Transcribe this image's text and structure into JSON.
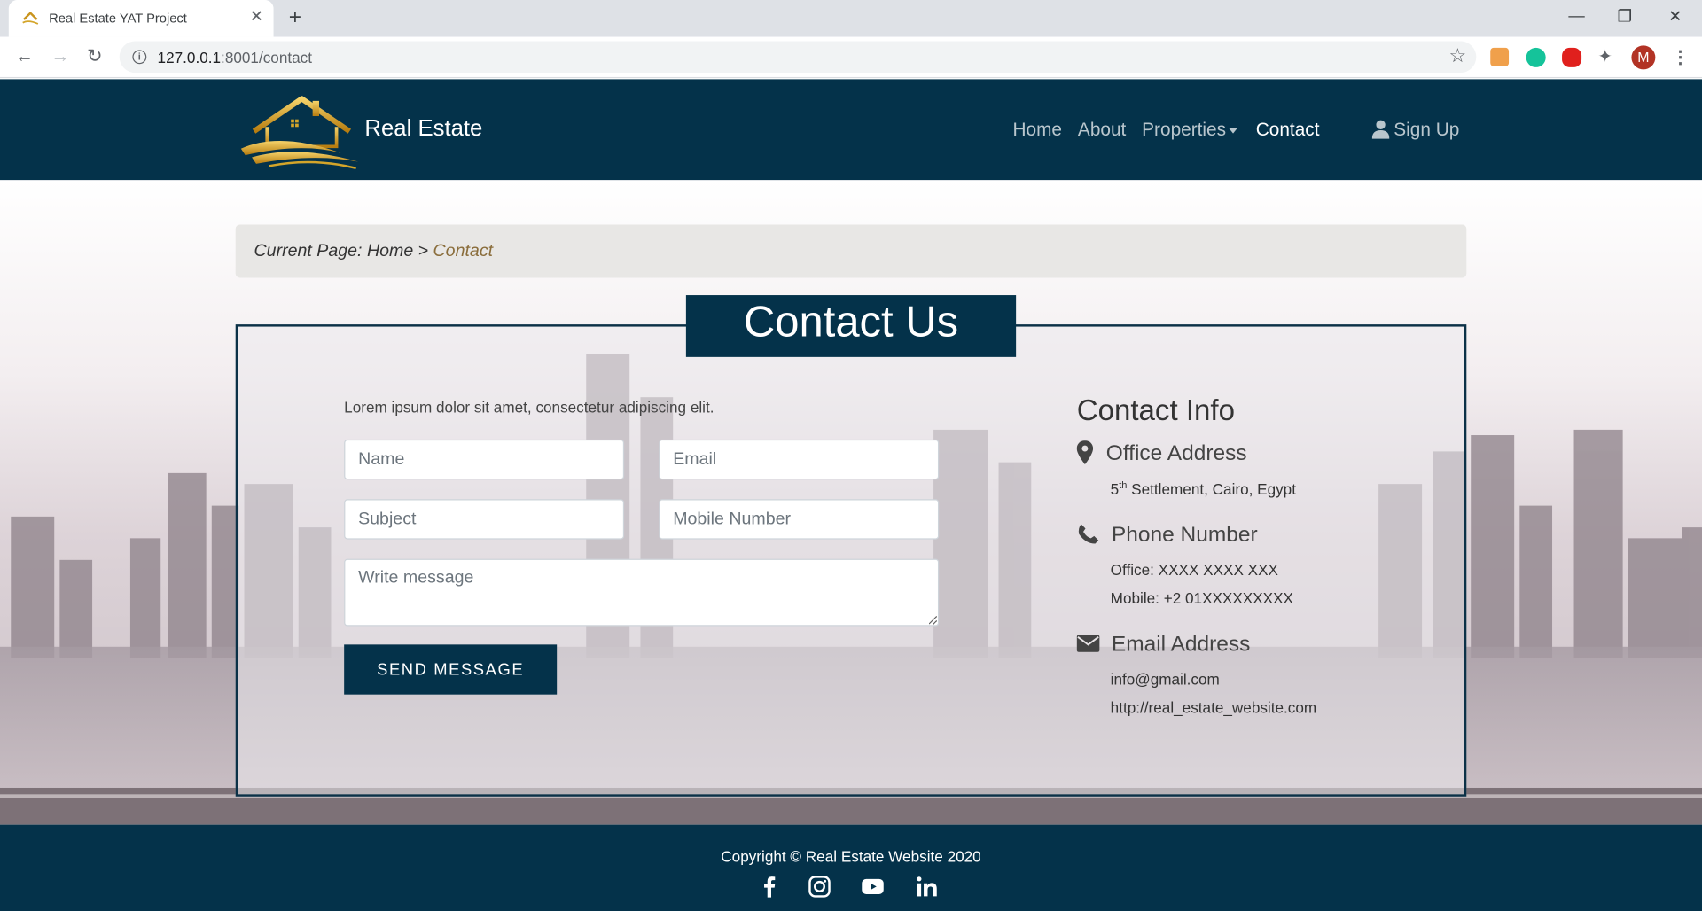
{
  "browser": {
    "tab_title": "Real Estate YAT Project",
    "url_host": "127.0.0.1",
    "url_rest": ":8001/contact",
    "profile_initial": "M"
  },
  "nav": {
    "brand": "Real Estate",
    "links": [
      "Home",
      "About",
      "Properties",
      "Contact"
    ],
    "active": "Contact",
    "signup": "Sign Up"
  },
  "breadcrumb": {
    "prefix": "Current Page: Home > ",
    "current": "Contact"
  },
  "contact": {
    "title": "Contact Us",
    "intro": "Lorem ipsum dolor sit amet, consectetur adipiscing elit.",
    "placeholders": {
      "name": "Name",
      "email": "Email",
      "subject": "Subject",
      "mobile": "Mobile Number",
      "message": "Write message"
    },
    "send_label": "SEND MESSAGE"
  },
  "info": {
    "title": "Contact Info",
    "office_head": "Office Address",
    "office_num": "5",
    "office_sup": "th",
    "office_rest": " Settlement, Cairo, Egypt",
    "phone_head": "Phone Number",
    "phone_office": "Office: XXXX XXXX XXX",
    "phone_mobile": "Mobile: +2 01XXXXXXXXX",
    "email_head": "Email Address",
    "email_1": "info@gmail.com",
    "email_2": "http://real_estate_website.com"
  },
  "footer": {
    "copyright": "Copyright © Real Estate Website 2020",
    "social_icons": [
      "facebook-icon",
      "instagram-icon",
      "youtube-icon",
      "linkedin-icon"
    ]
  },
  "colors": {
    "navy": "#04324a",
    "accent_breadcrumb": "#8a6d3b"
  }
}
